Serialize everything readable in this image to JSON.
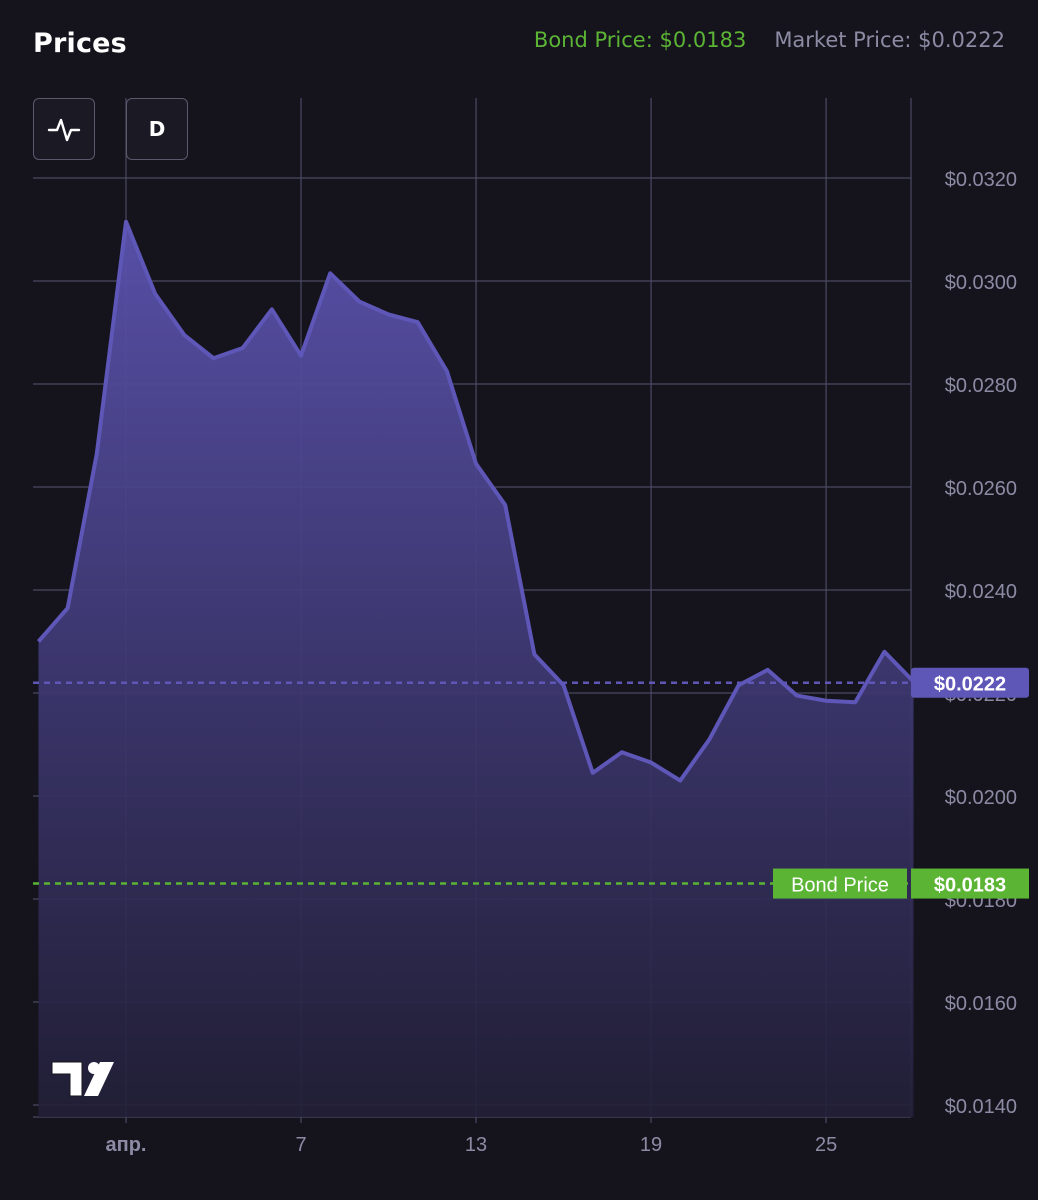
{
  "header": {
    "title": "Prices",
    "bond_price_label": "Bond Price: $0.0183",
    "market_price_label": "Market Price: $0.0222"
  },
  "toolbar": {
    "chart_type_icon": "line-chart-icon",
    "interval_label": "D"
  },
  "colors": {
    "background": "#15141d",
    "line": "#5e57b8",
    "fill_top": "#5a52ad",
    "fill_bottom": "#221f38",
    "grid": "#4b4962",
    "axis_text": "#8d8ba4",
    "bond": "#5cb435",
    "market": "#5e57b8"
  },
  "chart_data": {
    "type": "area",
    "x_tick_labels": [
      "апр.",
      "7",
      "13",
      "19",
      "25"
    ],
    "y_tick_labels": [
      "$0.0320",
      "$0.0300",
      "$0.0280",
      "$0.0260",
      "$0.0240",
      "$0.0220",
      "$0.0200",
      "$0.0180",
      "$0.0160",
      "$0.0140"
    ],
    "ylim": [
      0.014,
      0.032
    ],
    "x_tick_days": [
      1,
      7,
      13,
      19,
      25
    ],
    "grid": true,
    "x": [
      -2,
      -1,
      0,
      1,
      2,
      3,
      4,
      5,
      6,
      7,
      8,
      9,
      10,
      11,
      12,
      13,
      14,
      15,
      16,
      17,
      18,
      19,
      20,
      21,
      22,
      23,
      24,
      25,
      26,
      27,
      28
    ],
    "values": [
      0.023,
      0.02365,
      0.02665,
      0.03115,
      0.02975,
      0.02895,
      0.0285,
      0.0287,
      0.02945,
      0.02855,
      0.03015,
      0.0296,
      0.02935,
      0.0292,
      0.02825,
      0.02645,
      0.02565,
      0.02275,
      0.02215,
      0.02045,
      0.02085,
      0.02065,
      0.0203,
      0.0211,
      0.02215,
      0.02245,
      0.02195,
      0.02185,
      0.02182,
      0.0228,
      0.02222
    ],
    "reference_lines": [
      {
        "name": "Market Price",
        "value": 0.0222,
        "label": "$0.0222"
      },
      {
        "name": "Bond Price",
        "value": 0.0183,
        "label": "$0.0183",
        "tag": "Bond Price"
      }
    ]
  }
}
